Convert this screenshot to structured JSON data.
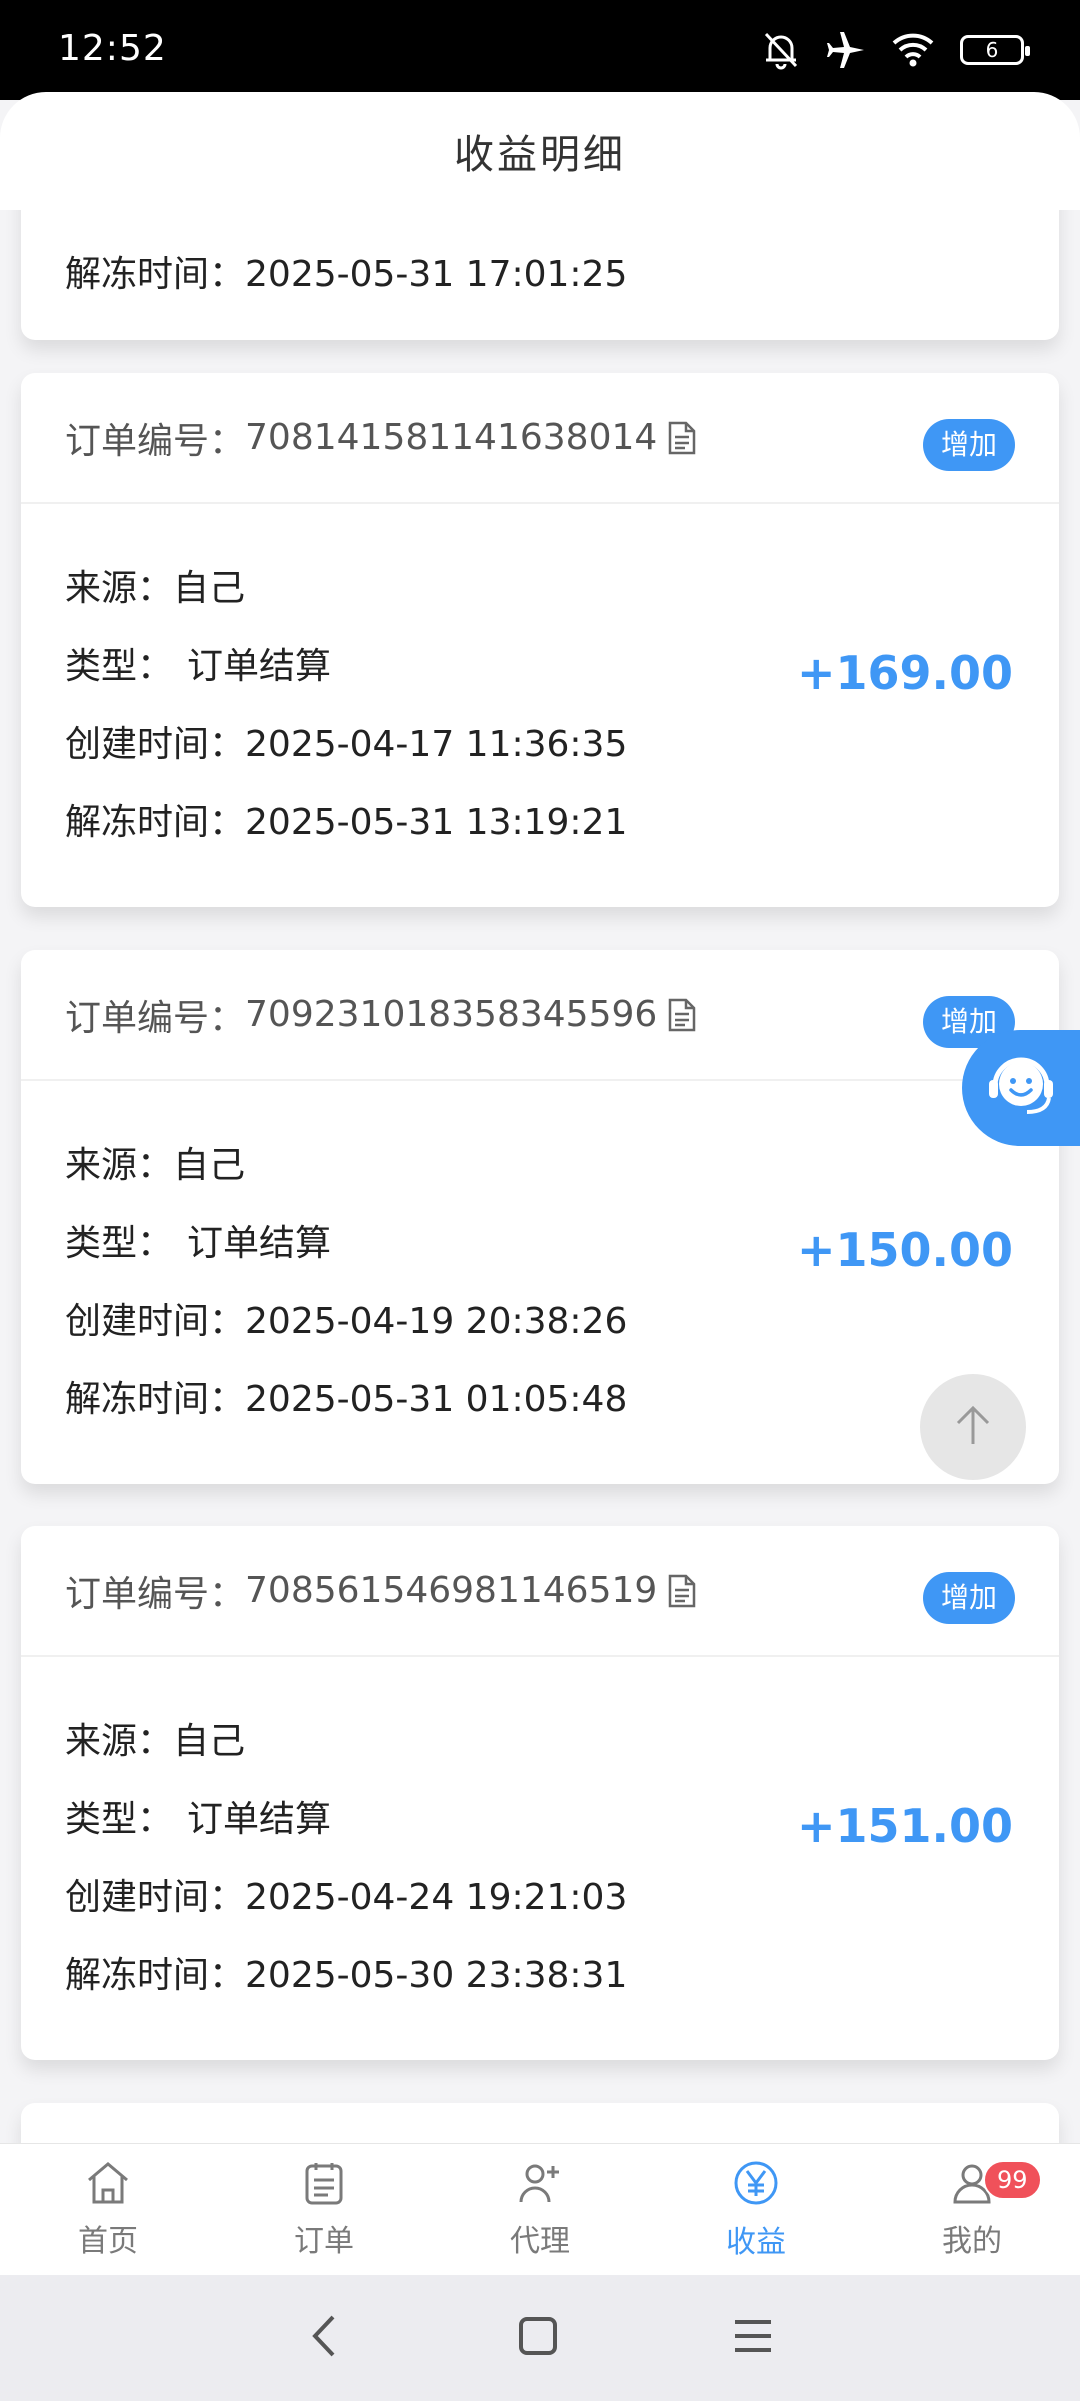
{
  "status_bar": {
    "time": "12:52",
    "battery": "6"
  },
  "header": {
    "title": "收益明细"
  },
  "labels": {
    "order_no": "订单编号：",
    "source": "来源：",
    "type": "类型：",
    "created": "创建时间：",
    "unfreeze": "解冻时间："
  },
  "partial_card": {
    "unfreeze_time": "2025-05-31 17:01:25"
  },
  "records": [
    {
      "order_no": "708141581141638014",
      "badge": "增加",
      "source": "自己",
      "type": "订单结算",
      "created": "2025-04-17 11:36:35",
      "unfreeze": "2025-05-31 13:19:21",
      "amount": "+169.00"
    },
    {
      "order_no": "709231018358345596",
      "badge": "增加",
      "source": "自己",
      "type": "订单结算",
      "created": "2025-04-19 20:38:26",
      "unfreeze": "2025-05-31 01:05:48",
      "amount": "+150.00"
    },
    {
      "order_no": "708561546981146519",
      "badge": "增加",
      "source": "自己",
      "type": "订单结算",
      "created": "2025-04-24 19:21:03",
      "unfreeze": "2025-05-30 23:38:31",
      "amount": "+151.00"
    }
  ],
  "tabbar": [
    {
      "label": "首页",
      "icon": "home-icon"
    },
    {
      "label": "订单",
      "icon": "order-list-icon"
    },
    {
      "label": "代理",
      "icon": "add-agent-icon"
    },
    {
      "label": "收益",
      "icon": "yuan-icon",
      "active": true
    },
    {
      "label": "我的",
      "icon": "user-icon",
      "badge": "99"
    }
  ],
  "colors": {
    "accent": "#3f97f5",
    "badge_red": "#f0515a"
  }
}
